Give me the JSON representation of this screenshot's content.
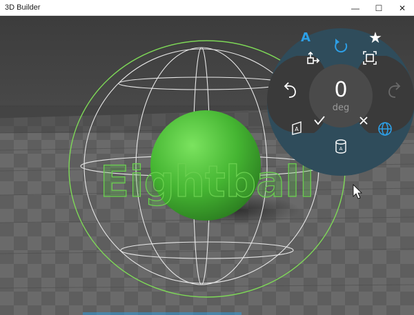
{
  "window": {
    "title": "3D Builder",
    "minimize_glyph": "—",
    "maximize_glyph": "☐",
    "close_glyph": "✕"
  },
  "scene": {
    "object_text": "Eightball",
    "object_color": "#4fbf3b",
    "gizmo_color": "#7ed957"
  },
  "control_wheel": {
    "rotation_value": "0",
    "rotation_unit": "deg",
    "tools": {
      "text": "A",
      "favorite": "★"
    },
    "accent_color": "#2d9fe6",
    "ring_color": "#2f4c5b",
    "hub_color": "#3b3b3b"
  }
}
